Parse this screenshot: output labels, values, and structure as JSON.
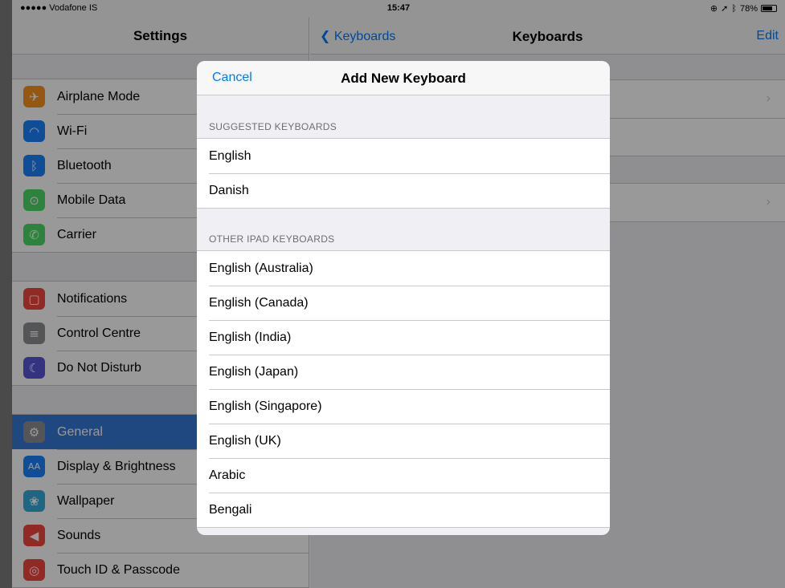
{
  "status_bar": {
    "carrier": "●●●●● Vodafone IS",
    "time": "15:47",
    "battery": "78%",
    "battery_level": 0.78
  },
  "settings": {
    "title": "Settings",
    "groups": [
      [
        {
          "label": "Airplane Mode",
          "icon": "airplane-icon",
          "color": "#f7931e",
          "glyph": "✈"
        },
        {
          "label": "Wi-Fi",
          "icon": "wifi-icon",
          "color": "#1a82fb",
          "glyph": "◠"
        },
        {
          "label": "Bluetooth",
          "icon": "bluetooth-icon",
          "color": "#1a82fb",
          "glyph": "ᛒ"
        },
        {
          "label": "Mobile Data",
          "icon": "antenna-icon",
          "color": "#4cd964",
          "glyph": "⊙"
        },
        {
          "label": "Carrier",
          "icon": "phone-icon",
          "color": "#4cd964",
          "glyph": "✆"
        }
      ],
      [
        {
          "label": "Notifications",
          "icon": "notifications-icon",
          "color": "#f2463c",
          "glyph": "▢"
        },
        {
          "label": "Control Centre",
          "icon": "control-centre-icon",
          "color": "#8e8e93",
          "glyph": "≡"
        },
        {
          "label": "Do Not Disturb",
          "icon": "moon-icon",
          "color": "#5856d6",
          "glyph": "☾"
        }
      ],
      [
        {
          "label": "General",
          "icon": "gear-icon",
          "color": "#8e8e93",
          "glyph": "⚙",
          "selected": true
        },
        {
          "label": "Display & Brightness",
          "icon": "display-icon",
          "color": "#1a82fb",
          "glyph": "AA"
        },
        {
          "label": "Wallpaper",
          "icon": "wallpaper-icon",
          "color": "#34aadc",
          "glyph": "❀"
        },
        {
          "label": "Sounds",
          "icon": "sounds-icon",
          "color": "#f2463c",
          "glyph": "◀"
        },
        {
          "label": "Touch ID & Passcode",
          "icon": "fingerprint-icon",
          "color": "#f2463c",
          "glyph": "◎"
        }
      ]
    ]
  },
  "keyboards": {
    "back_label": "Keyboards",
    "title": "Keyboards",
    "edit_label": "Edit"
  },
  "modal": {
    "cancel_label": "Cancel",
    "title": "Add New Keyboard",
    "sections": [
      {
        "header": "SUGGESTED KEYBOARDS",
        "items": [
          "English",
          "Danish"
        ]
      },
      {
        "header": "OTHER IPAD KEYBOARDS",
        "items": [
          "English (Australia)",
          "English (Canada)",
          "English (India)",
          "English (Japan)",
          "English (Singapore)",
          "English (UK)",
          "Arabic",
          "Bengali"
        ]
      }
    ]
  },
  "colors": {
    "accent": "#007aff",
    "selected_row": "#3478d8"
  }
}
